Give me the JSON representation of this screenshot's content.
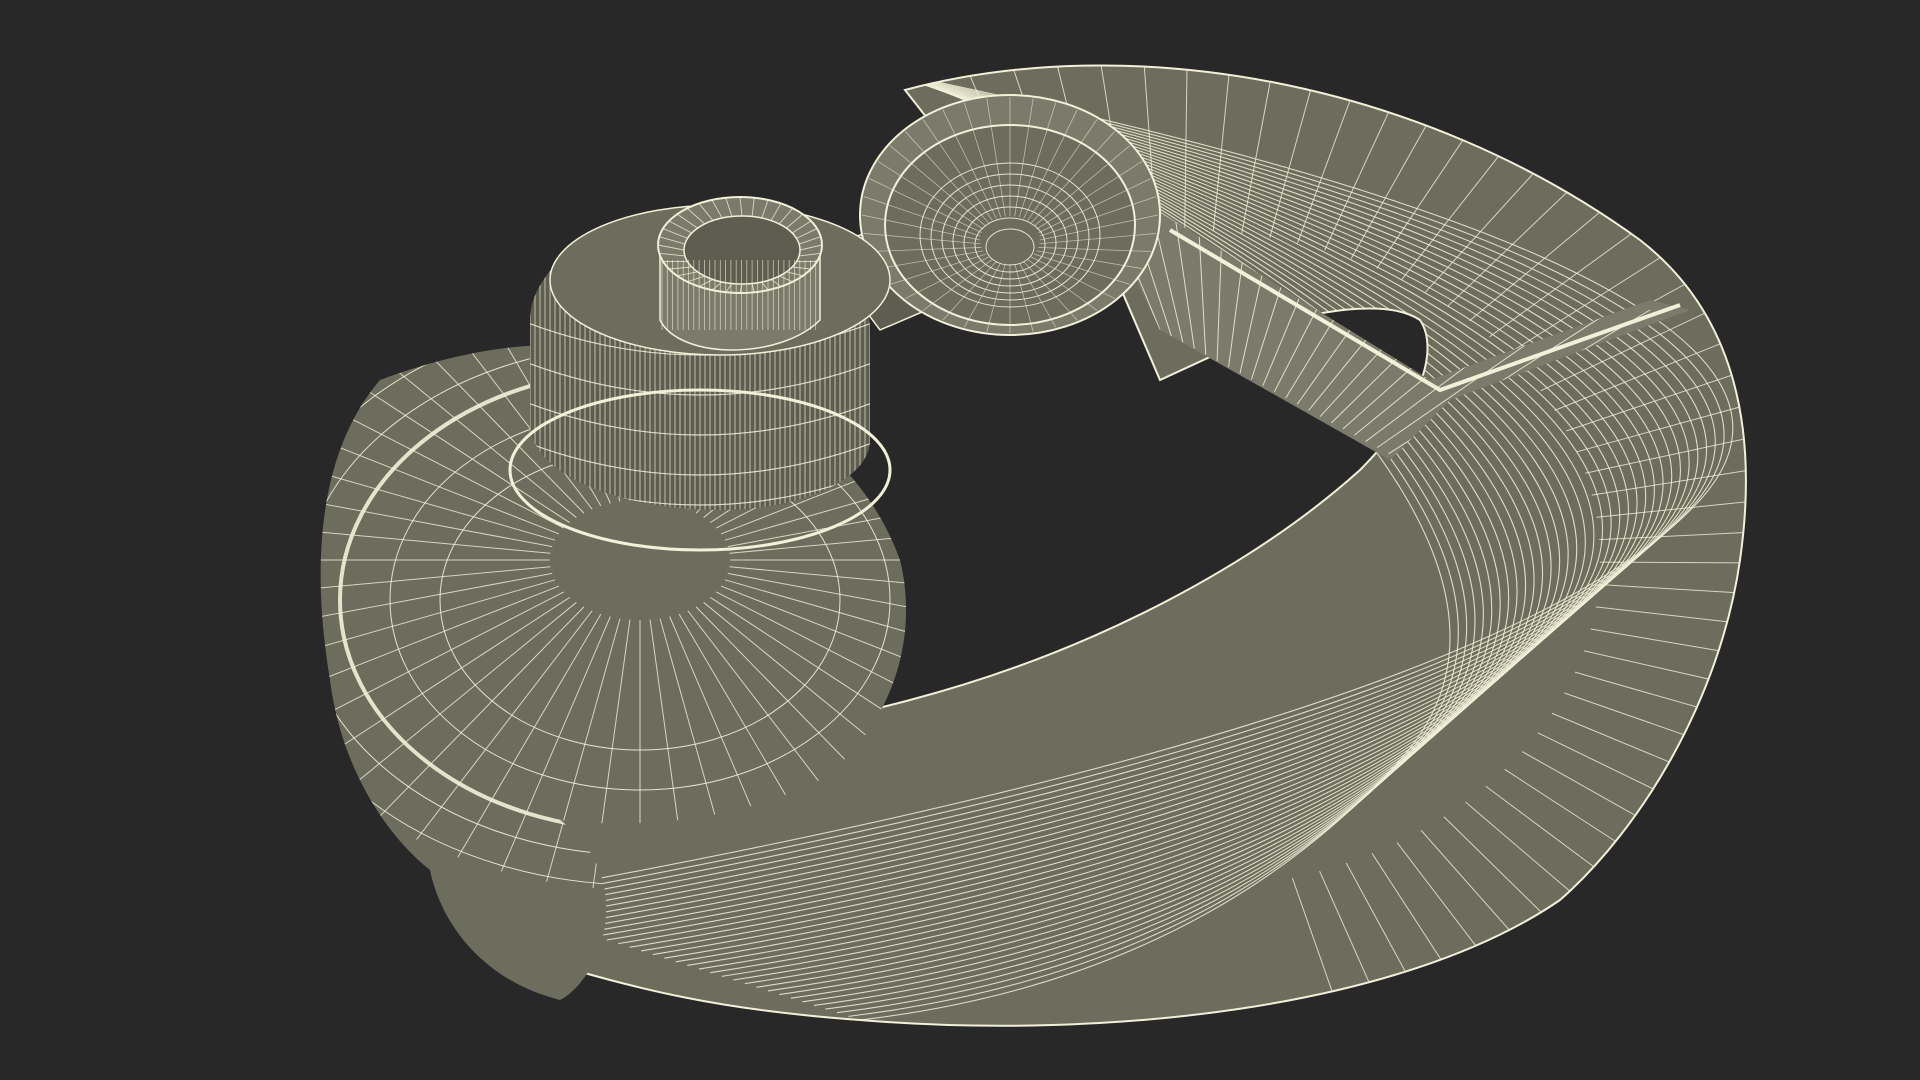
{
  "scene": {
    "subject": "tube-wireframe",
    "colors": {
      "background": "#282828",
      "surface": "#6d6d5e",
      "surface_dark": "#5e5e50",
      "surface_light": "#7b7b6b",
      "wire": "#f2f0d8"
    }
  }
}
